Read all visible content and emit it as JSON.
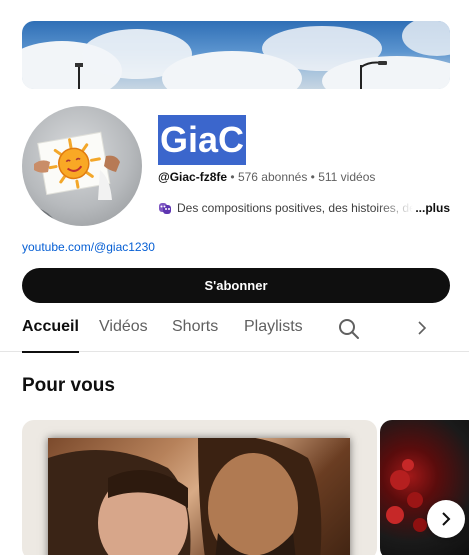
{
  "channel": {
    "name": "GiaC",
    "handle": "@Giac-fz8fe",
    "separator": " • ",
    "subscribers": "576 abonnés",
    "videos": "511 vidéos",
    "description": "Des compositions positives, des histoires, de",
    "more_label": "...plus",
    "link": "youtube.com/@giac1230"
  },
  "actions": {
    "subscribe_label": "S'abonner"
  },
  "tabs": [
    {
      "label": "Accueil",
      "active": true
    },
    {
      "label": "Vidéos",
      "active": false
    },
    {
      "label": "Shorts",
      "active": false
    },
    {
      "label": "Playlists",
      "active": false
    }
  ],
  "icons": {
    "search": "search-icon",
    "tabs_next": "chevron-right-icon",
    "carousel_next": "chevron-right-icon",
    "description_emoji": "performing-arts-icon"
  },
  "sections": {
    "for_you_title": "Pour vous"
  },
  "colors": {
    "name_highlight": "#3b66cc",
    "subscribe_bg": "#0f0f0f",
    "link": "#065fd4"
  }
}
